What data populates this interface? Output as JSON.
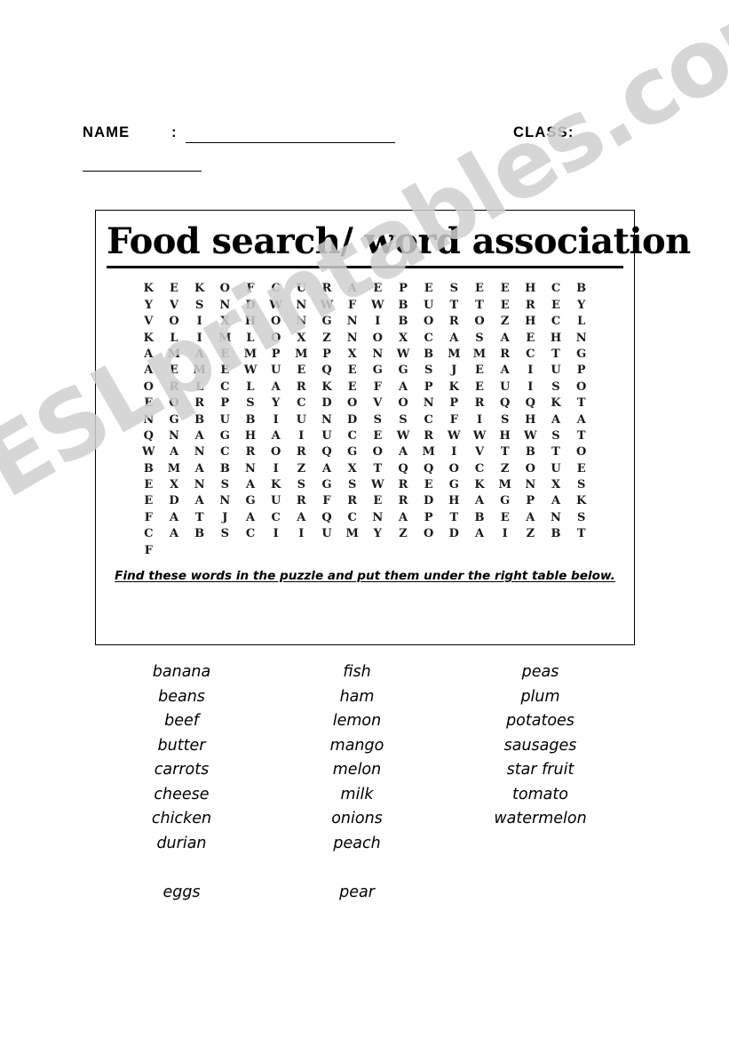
{
  "watermark": {
    "text": "ESLprintables.com"
  },
  "header": {
    "name_label": "NAME",
    "colon": ":",
    "class_label": "CLASS:"
  },
  "puzzle": {
    "title": "Food search/ word association",
    "instruction": "Find these words in the puzzle and put them under the right table below.",
    "grid_rows": 16,
    "grid_cols": 18,
    "grid": [
      [
        "K",
        "E",
        "K",
        "O",
        "F",
        "C",
        "U",
        "R",
        "A",
        "E",
        "P",
        "E",
        "S",
        "E",
        "E",
        "H",
        "C"
      ],
      [
        "B",
        "Y",
        "V",
        "S",
        "N",
        "D",
        "W",
        "N",
        "W",
        "F",
        "W",
        "B",
        "U",
        "T",
        "T",
        "E",
        "R"
      ],
      [
        "E",
        "Y",
        "V",
        "O",
        "I",
        "X",
        "H",
        "O",
        "N",
        "G",
        "N",
        "I",
        "B",
        "O",
        "R",
        "O",
        "Z"
      ],
      [
        "H",
        "C",
        "L",
        "K",
        "L",
        "I",
        "M",
        "L",
        "O",
        "X",
        "Z",
        "N",
        "O",
        "X",
        "C",
        "A",
        "S"
      ],
      [
        "A",
        "E",
        "H",
        "N",
        "A",
        "M",
        "A",
        "E",
        "M",
        "P",
        "M",
        "P",
        "X",
        "N",
        "W",
        "B",
        "M"
      ],
      [
        "M",
        "R",
        "C",
        "T",
        "G",
        "A",
        "E",
        "M",
        "E",
        "W",
        "U",
        "E",
        "Q",
        "E",
        "G",
        "G",
        "S"
      ],
      [
        "J",
        "E",
        "A",
        "I",
        "U",
        "P",
        "O",
        "R",
        "L",
        "C",
        "L",
        "A",
        "R",
        "K",
        "E",
        "F",
        "A"
      ],
      [
        "P",
        "K",
        "E",
        "U",
        "I",
        "S",
        "O",
        "E",
        "O",
        "R",
        "P",
        "S",
        "Y",
        "C",
        "D",
        "O",
        "V"
      ],
      [
        "O",
        "N",
        "P",
        "R",
        "Q",
        "Q",
        "K",
        "T",
        "N",
        "G",
        "B",
        "U",
        "B",
        "I",
        "U",
        "N",
        "D"
      ],
      [
        "S",
        "S",
        "C",
        "F",
        "I",
        "S",
        "H",
        "A",
        "A",
        "Q",
        "N",
        "A",
        "G",
        "H",
        "A",
        "I",
        "U"
      ],
      [
        "C",
        "E",
        "W",
        "R",
        "W",
        "W",
        "H",
        "W",
        "S",
        "T",
        "W",
        "A",
        "N",
        "C",
        "R",
        "O",
        "R"
      ],
      [
        "Q",
        "G",
        "O",
        "A",
        "M",
        "I",
        "V",
        "T",
        "B",
        "T",
        "O",
        "B",
        "M",
        "A",
        "B",
        "N",
        "I"
      ],
      [
        "Z",
        "A",
        "X",
        "T",
        "Q",
        "Q",
        "O",
        "C",
        "Z",
        "O",
        "U",
        "E",
        "E",
        "X",
        "N",
        "S",
        "A"
      ],
      [
        "K",
        "S",
        "G",
        "S",
        "W",
        "R",
        "E",
        "G",
        "K",
        "M",
        "N",
        "X",
        "S",
        "E",
        "D",
        "A",
        "N"
      ],
      [
        "G",
        "U",
        "R",
        "F",
        "R",
        "E",
        "R",
        "D",
        "H",
        "A",
        "G",
        "P",
        "A",
        "K",
        "F",
        "A",
        "T"
      ],
      [
        "J",
        "A",
        "C",
        "A",
        "Q",
        "C",
        "N",
        "A",
        "P",
        "T",
        "B",
        "E",
        "A",
        "N",
        "S",
        "C",
        "A"
      ],
      [
        "B",
        "S",
        "C",
        "I",
        "I",
        "U",
        "M",
        "Y",
        "Z",
        "O",
        "D",
        "A",
        "I",
        "Z",
        "B",
        "T",
        "F"
      ]
    ]
  },
  "word_list": {
    "column1": [
      "banana",
      "beans",
      "beef",
      "butter",
      "carrots",
      "cheese",
      "chicken",
      "durian",
      "",
      "eggs"
    ],
    "column2": [
      "fish",
      "ham",
      "lemon",
      "mango",
      "melon",
      "milk",
      "onions",
      "peach",
      "",
      "pear"
    ],
    "column3": [
      "peas",
      "plum",
      "potatoes",
      "sausages",
      "star fruit",
      "tomato",
      "watermelon"
    ]
  }
}
